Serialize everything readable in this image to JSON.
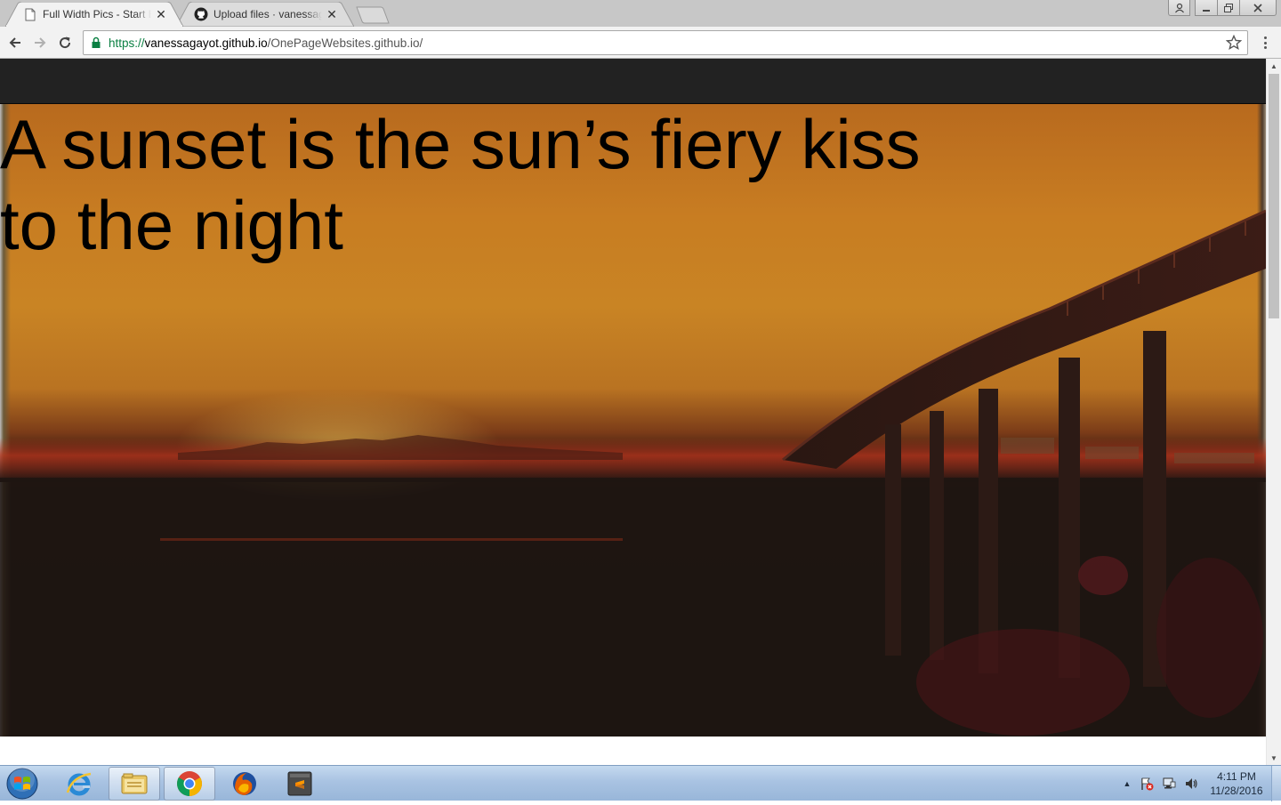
{
  "browser": {
    "tabs": [
      {
        "title": "Full Width Pics - Start Bo",
        "favicon": "page-icon",
        "active": true
      },
      {
        "title": "Upload files · vanessagay",
        "favicon": "github-icon",
        "active": false
      }
    ],
    "close_glyph": "✕",
    "address": {
      "scheme": "https://",
      "host": "vanessagayot.github.io",
      "path": "/OnePageWebsites.github.io/"
    },
    "window_buttons": [
      "user-icon",
      "minimize-icon",
      "maximize-icon",
      "close-icon"
    ]
  },
  "page": {
    "quote_line1": "A sunset is the sun’s fiery kiss",
    "quote_line2": "to the night",
    "nav_bar_color": "#222222"
  },
  "taskbar": {
    "pinned": [
      "internet-explorer-icon",
      "file-explorer-icon",
      "chrome-icon",
      "firefox-icon",
      "sublime-text-icon"
    ],
    "tray_arrow": "▲",
    "clock_time": "4:11 PM",
    "clock_date": "11/28/2016"
  },
  "scrollbar": {
    "up_glyph": "▲",
    "down_glyph": "▼"
  }
}
